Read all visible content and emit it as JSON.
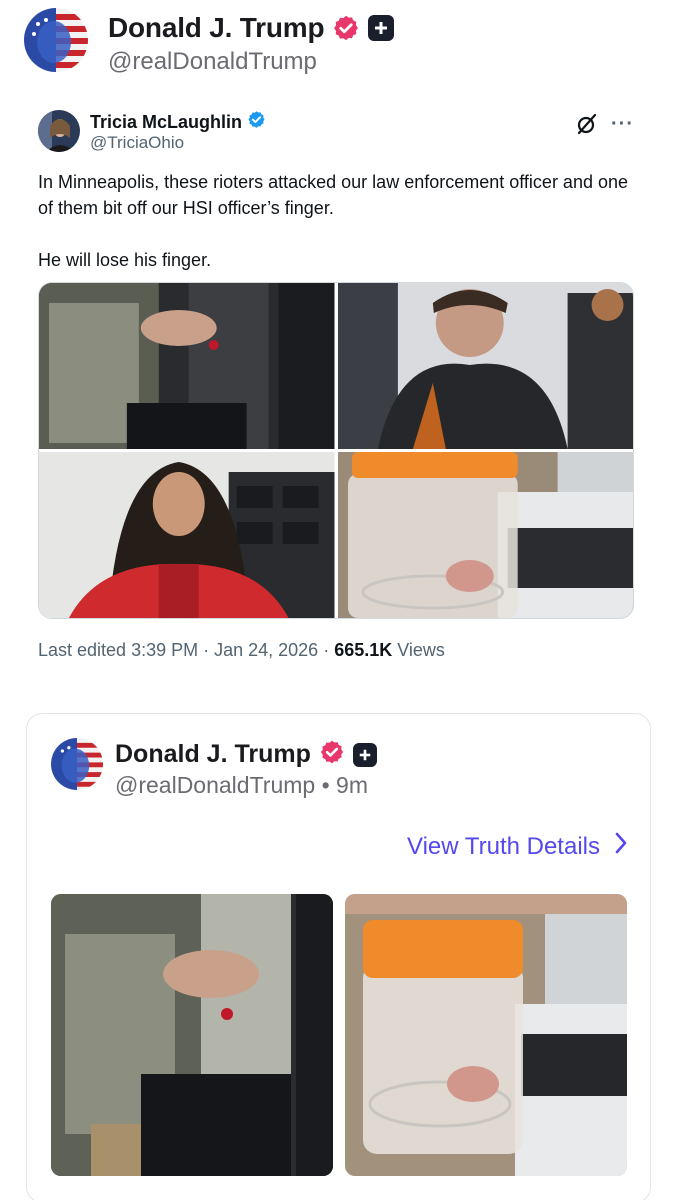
{
  "post": {
    "author_name": "Donald J. Trump",
    "author_handle": "@realDonaldTrump"
  },
  "quoted_tweet": {
    "author_name": "Tricia McLaughlin",
    "author_handle": "@TriciaOhio",
    "text_line_1": "In Minneapolis, these rioters attacked our law enforcement officer and one of them bit off our HSI officer’s finger.",
    "text_line_2": "He will lose his finger.",
    "meta_prefix": "Last edited 3:39 PM · Jan 24, 2026 · ",
    "views_count": "665.1K",
    "views_label": " Views",
    "media": [
      {
        "description": "officer-hand-photo"
      },
      {
        "description": "detained-man-photo"
      },
      {
        "description": "detained-woman-photo"
      },
      {
        "description": "finger-in-jar-photo"
      }
    ]
  },
  "truth_card": {
    "author_name": "Donald J. Trump",
    "author_handle": "@realDonaldTrump",
    "separator": " • ",
    "time_ago": "9m",
    "view_details_label": "View Truth Details",
    "chevron": "›"
  },
  "colors": {
    "verified_pink": "#e8376b",
    "verified_blue": "#1d9bf0",
    "link_purple": "#5448ee",
    "muted_text": "#6b6b73"
  }
}
